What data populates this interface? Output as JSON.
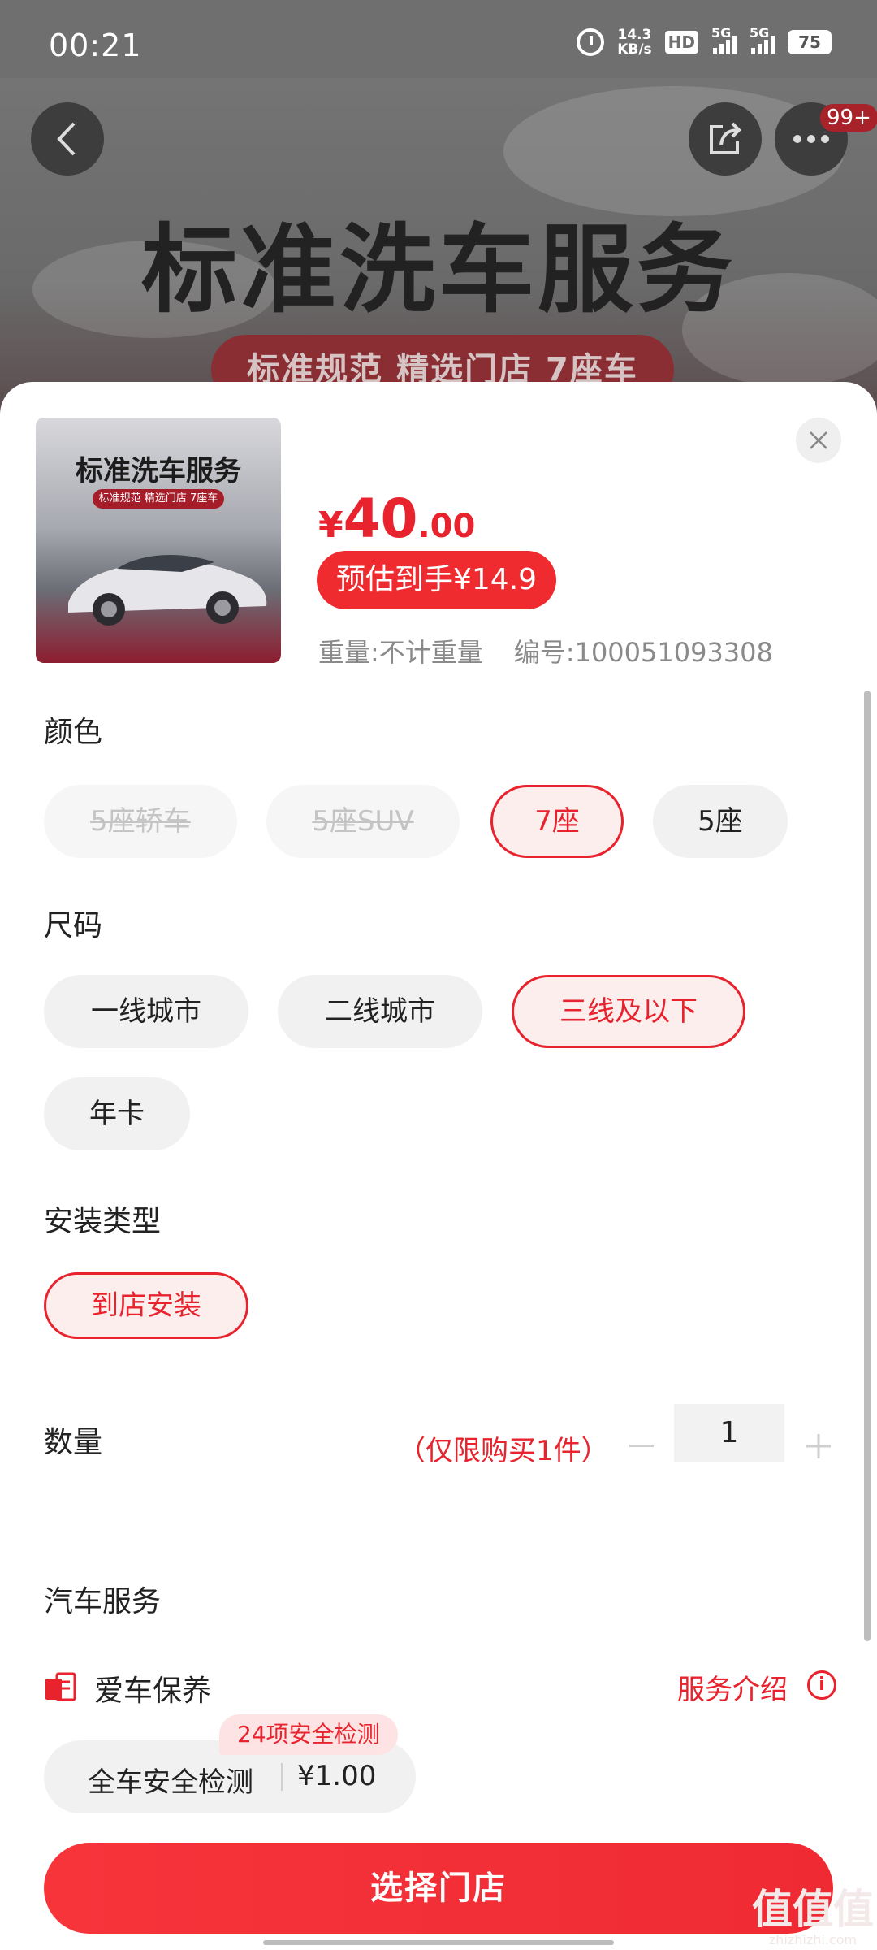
{
  "status_bar": {
    "time": "00:21",
    "net_speed_value": "14.3",
    "net_speed_unit": "KB/s",
    "hd_label": "HD",
    "sim1_label": "5G",
    "sim2_label": "5G",
    "battery": "75"
  },
  "hero": {
    "title": "标准洗车服务",
    "subtitle": "标准规范 精选门店 7座车",
    "more_badge": "99+"
  },
  "product": {
    "thumb_title": "标准洗车服务",
    "thumb_subtitle": "标准规范 精选门店 7座车",
    "price_symbol": "¥",
    "price_int": "40",
    "price_dec": ".00",
    "estimated": "预估到手¥14.9",
    "weight": "重量:不计重量",
    "sku": "编号:100051093308"
  },
  "color_section": {
    "title": "颜色",
    "options": [
      "5座轿车",
      "5座SUV",
      "7座",
      "5座"
    ]
  },
  "size_section": {
    "title": "尺码",
    "options": [
      "一线城市",
      "二线城市",
      "三线及以下",
      "年卡"
    ]
  },
  "install_section": {
    "title": "安装类型",
    "options": [
      "到店安装"
    ]
  },
  "quantity": {
    "title": "数量",
    "note": "（仅限购买1件）",
    "value": "1"
  },
  "car_service": {
    "title": "汽车服务",
    "item_label": "爱车保养",
    "intro_label": "服务介绍",
    "chip_name": "全车安全检测",
    "chip_price": "¥1.00",
    "chip_tag": "24项安全检测"
  },
  "cta": {
    "label": "选择门店"
  },
  "watermark": {
    "big": "值值值",
    "small": "zhizhizhi.com"
  },
  "colors": {
    "accent": "#e8232d",
    "cta": "#f6343a"
  }
}
